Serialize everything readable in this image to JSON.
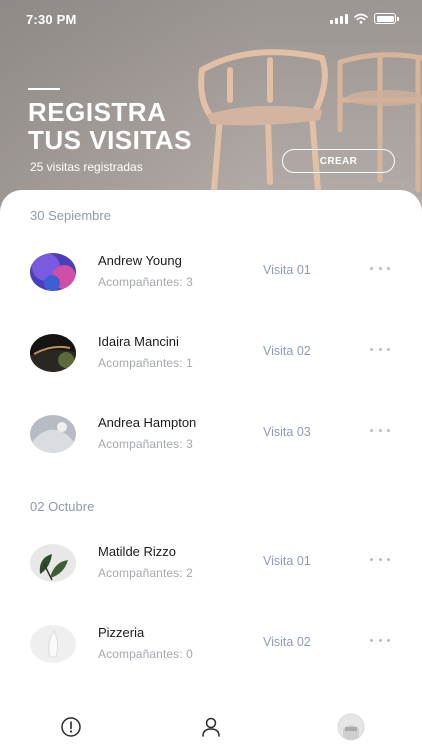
{
  "status_bar": {
    "time": "7:30 PM",
    "icons": [
      "signal-icon",
      "wifi-icon",
      "battery-icon"
    ]
  },
  "hero": {
    "title_line1": "REGISTRA",
    "title_line2": "TUS VISITAS",
    "count": "25 visitas registradas",
    "create_label": "CREAR"
  },
  "sections": [
    {
      "date": "30 Sepiembre",
      "visits": [
        {
          "name": "Andrew Young",
          "companions": "Acompañantes: 3",
          "visit": "Visita 01",
          "avatar": "avatar-purple-pink"
        },
        {
          "name": "Idaira Mancini",
          "companions": "Acompañantes: 1",
          "visit": "Visita 02",
          "avatar": "avatar-dark"
        },
        {
          "name": "Andrea Hampton",
          "companions": "Acompañantes: 3",
          "visit": "Visita 03",
          "avatar": "avatar-light-gray"
        }
      ]
    },
    {
      "date": "02 Octubre",
      "visits": [
        {
          "name": "Matilde Rizzo",
          "companions": "Acompañantes: 2",
          "visit": "Visita 01",
          "avatar": "avatar-plant"
        },
        {
          "name": "Pizzeria",
          "companions": "Acompañantes: 0",
          "visit": "Visita 02",
          "avatar": "avatar-white"
        }
      ]
    }
  ],
  "tabbar": {
    "items": [
      "alert-icon",
      "user-icon",
      "profile-avatar"
    ]
  },
  "colors": {
    "accent": "#8f9bb6",
    "date": "#8e9ab0",
    "muted": "#a5a8b2",
    "text": "#1b1b1b"
  }
}
